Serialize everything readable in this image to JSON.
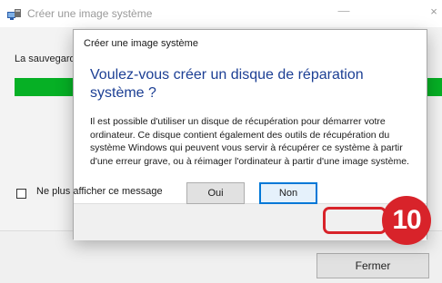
{
  "background_window": {
    "title": "Créer une image système",
    "minimize": "—",
    "close": "×",
    "status_text": "La sauvegarde",
    "progress": 1.0,
    "fermer_label": "Fermer"
  },
  "dialog": {
    "title": "Créer une image système",
    "heading": "Voulez-vous créer un disque de réparation système ?",
    "body": "Il est possible d'utiliser un disque de récupération pour démarrer votre ordinateur. Ce disque contient également des outils de récupération du système Windows qui peuvent vous servir à récupérer ce système à partir d'une erreur grave, ou à réimager l'ordinateur à partir d'une image système.",
    "checkbox_label": "Ne plus afficher ce message",
    "checkbox_checked": false,
    "buttons": {
      "oui": "Oui",
      "non": "Non"
    }
  },
  "annotation": {
    "step": "10"
  },
  "colors": {
    "heading": "#1c3f94",
    "progress": "#06b025",
    "annotation": "#d8232a",
    "default_button_border": "#0078d7"
  }
}
